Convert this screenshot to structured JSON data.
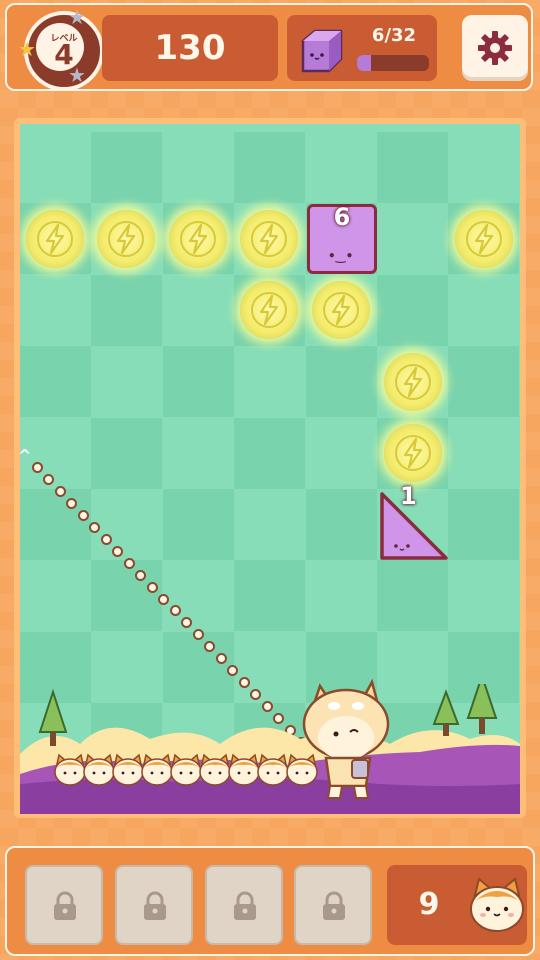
{
  "header": {
    "level_label": "レベル",
    "level_number": "4",
    "score": "130",
    "progress_text": "6/32",
    "progress_fraction": 0.1875,
    "settings_icon": "gear-icon"
  },
  "board": {
    "blocks": [
      {
        "shape": "square",
        "hits": "6"
      },
      {
        "shape": "triangle",
        "hits": "1"
      }
    ],
    "powerups": "lightning-bolt",
    "aim_marker": "^"
  },
  "footer": {
    "locked_slots": 4,
    "lock_icon": "lock-icon",
    "balls_remaining": "9"
  },
  "colors": {
    "accent_orange": "#ee8c43",
    "dark_brown": "#8b3b2a",
    "board_green": "#86ddb8",
    "block_purple": "#cf95e8",
    "bolt_yellow": "#f3ec6d"
  }
}
